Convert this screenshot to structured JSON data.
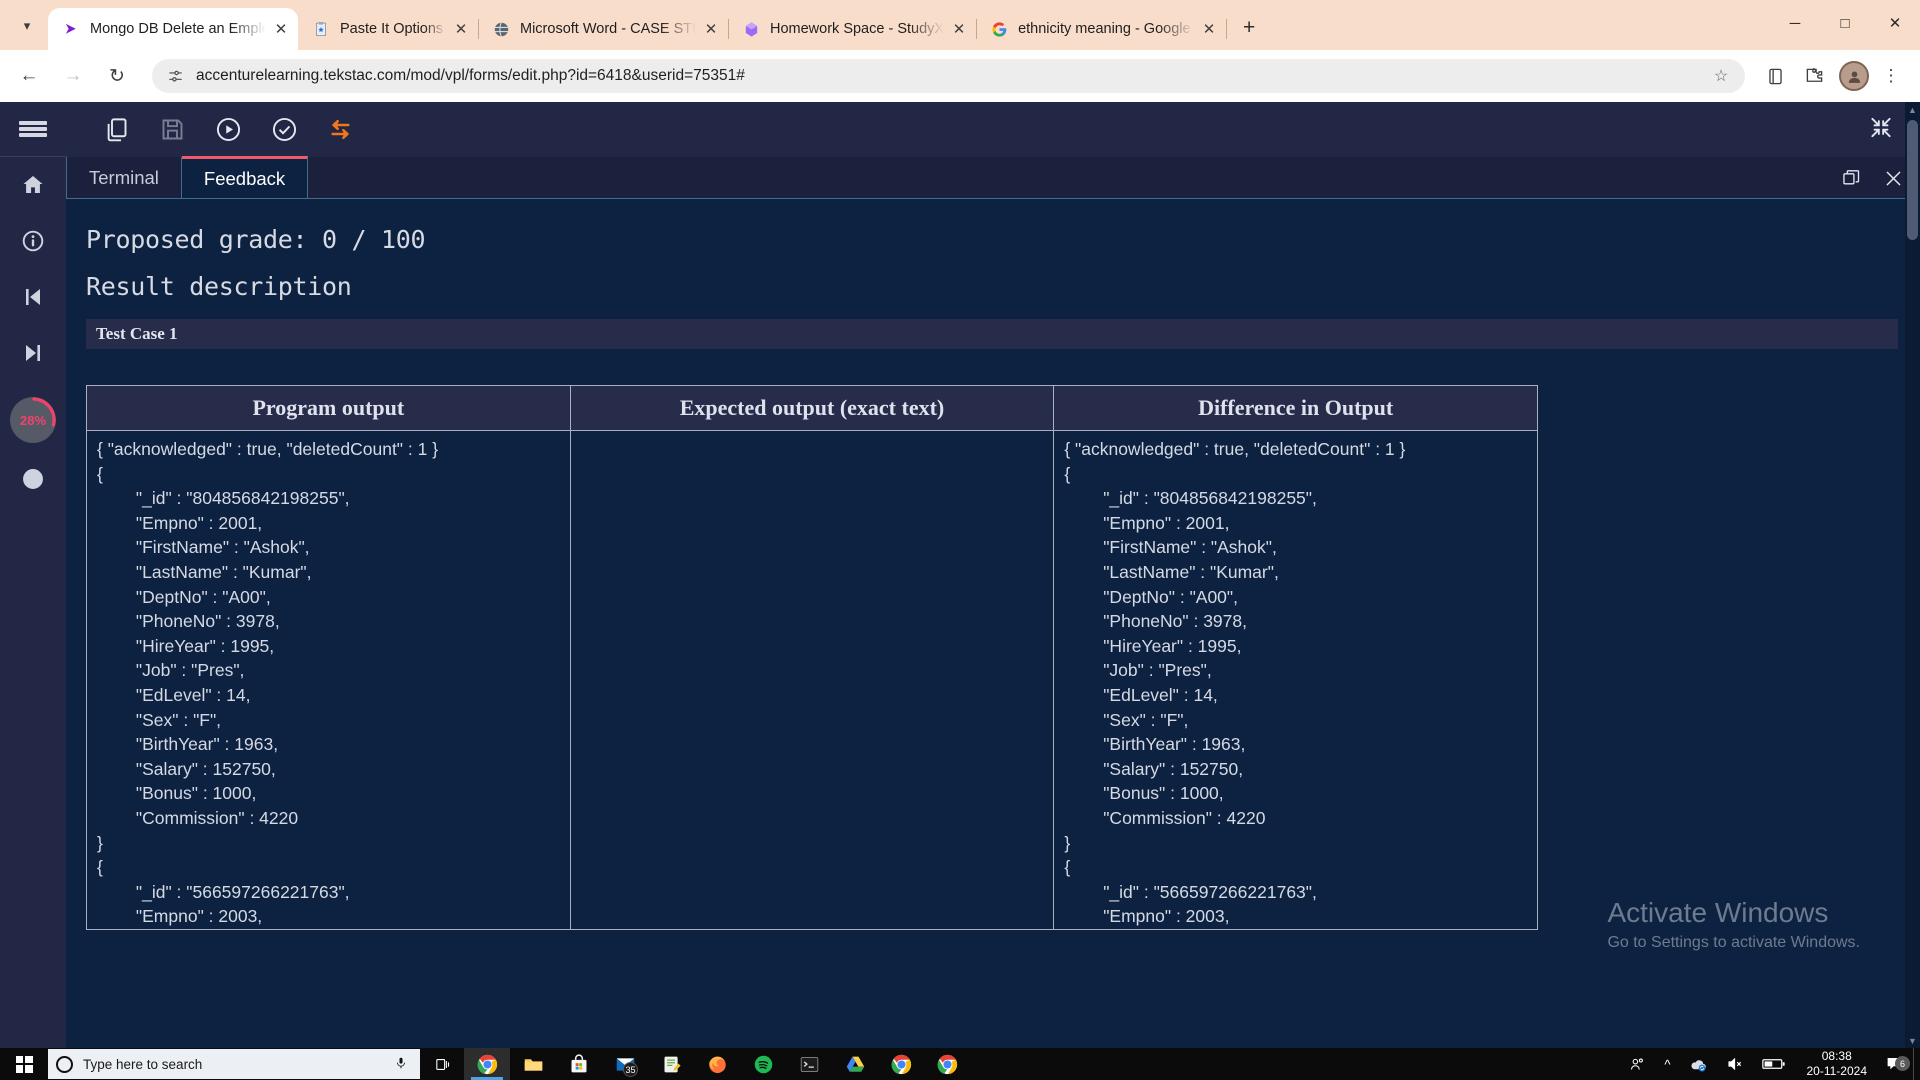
{
  "browser": {
    "tab_search_icon": "chevron-down-icon",
    "tabs": [
      {
        "title": "Mongo DB Delete an Employee",
        "favicon": "mongodb-icon",
        "active": true
      },
      {
        "title": "Paste It Options",
        "favicon": "clipboard-icon",
        "active": false
      },
      {
        "title": "Microsoft Word - CASE STUDY",
        "favicon": "word-globe-icon",
        "active": false
      },
      {
        "title": "Homework Space - StudyX",
        "favicon": "studyx-icon",
        "active": false
      },
      {
        "title": "ethnicity meaning - Google Sea",
        "favicon": "google-icon",
        "active": false
      }
    ],
    "new_tab_label": "+",
    "close_tab_label": "✕",
    "window_controls": {
      "minimize": "─",
      "maximize": "□",
      "close": "✕"
    },
    "nav": {
      "back": "←",
      "forward": "→",
      "reload": "↻"
    },
    "omnibox": {
      "url": "accenturelearning.tekstac.com/mod/vpl/forms/edit.php?id=6418&userid=75351#",
      "site_info_icon": "tune-icon",
      "bookmark_icon": "star-icon"
    },
    "toolbar_icons": [
      {
        "name": "reading-list-icon",
        "glyph": "☰"
      },
      {
        "name": "extensions-icon",
        "glyph": "⧉"
      },
      {
        "name": "profile-avatar",
        "glyph": ""
      },
      {
        "name": "chrome-menu-icon",
        "glyph": "⋮"
      }
    ]
  },
  "sidebar": {
    "hamburger": "menu-icon",
    "items": [
      {
        "name": "home-icon",
        "label": "Home"
      },
      {
        "name": "info-icon",
        "label": "Info"
      },
      {
        "name": "previous-icon",
        "label": "Previous"
      },
      {
        "name": "next-icon",
        "label": "Next"
      },
      {
        "name": "help-icon",
        "label": "Help"
      }
    ],
    "progress": {
      "value": "28%",
      "color": "#f0426b"
    }
  },
  "vpl_toolbar": {
    "buttons": [
      {
        "name": "copy-files-icon",
        "label": "Copy"
      },
      {
        "name": "save-icon",
        "label": "Save",
        "disabled": true
      },
      {
        "name": "run-icon",
        "label": "Run"
      },
      {
        "name": "evaluate-icon",
        "label": "Evaluate"
      },
      {
        "name": "reset-icon",
        "label": "Reset",
        "accent": "#f4761b"
      }
    ],
    "collapse_icon": "collapse-arrows-icon"
  },
  "panel": {
    "tabs": [
      {
        "label": "Terminal",
        "active": false
      },
      {
        "label": "Feedback",
        "active": true
      }
    ],
    "restore_icon": "restore-window-icon",
    "close_icon": "close-panel-icon"
  },
  "feedback": {
    "proposed_grade": "Proposed grade: 0 / 100",
    "result_description": "Result description",
    "test_case_label": "Test Case 1",
    "table": {
      "headers": [
        "Program output",
        "Expected output (exact text)",
        "Difference in Output"
      ],
      "program_output": "{ \"acknowledged\" : true, \"deletedCount\" : 1 }\n{\n\t\"_id\" : \"804856842198255\",\n\t\"Empno\" : 2001,\n\t\"FirstName\" : \"Ashok\",\n\t\"LastName\" : \"Kumar\",\n\t\"DeptNo\" : \"A00\",\n\t\"PhoneNo\" : 3978,\n\t\"HireYear\" : 1995,\n\t\"Job\" : \"Pres\",\n\t\"EdLevel\" : 14,\n\t\"Sex\" : \"F\",\n\t\"BirthYear\" : 1963,\n\t\"Salary\" : 152750,\n\t\"Bonus\" : 1000,\n\t\"Commission\" : 4220\n}\n{\n\t\"_id\" : \"566597266221763\",\n\t\"Empno\" : 2003,",
      "expected_output": "",
      "difference_output": "{ \"acknowledged\" : true, \"deletedCount\" : 1 }\n{\n\t\"_id\" : \"804856842198255\",\n\t\"Empno\" : 2001,\n\t\"FirstName\" : \"Ashok\",\n\t\"LastName\" : \"Kumar\",\n\t\"DeptNo\" : \"A00\",\n\t\"PhoneNo\" : 3978,\n\t\"HireYear\" : 1995,\n\t\"Job\" : \"Pres\",\n\t\"EdLevel\" : 14,\n\t\"Sex\" : \"F\",\n\t\"BirthYear\" : 1963,\n\t\"Salary\" : 152750,\n\t\"Bonus\" : 1000,\n\t\"Commission\" : 4220\n}\n{\n\t\"_id\" : \"566597266221763\",\n\t\"Empno\" : 2003,"
    }
  },
  "watermark": {
    "title": "Activate Windows",
    "subtitle": "Go to Settings to activate Windows."
  },
  "taskbar": {
    "start_label": "Start",
    "search_placeholder": "Type here to search",
    "mic_icon": "microphone-icon",
    "taskview_icon": "task-view-icon",
    "apps": [
      {
        "name": "chrome-taskbar-icon",
        "label": "Google Chrome",
        "active": true
      },
      {
        "name": "file-explorer-icon",
        "label": "File Explorer"
      },
      {
        "name": "microsoft-store-icon",
        "label": "Microsoft Store"
      },
      {
        "name": "mail-icon",
        "label": "Mail",
        "badge": "35"
      },
      {
        "name": "notes-icon",
        "label": "Notes"
      },
      {
        "name": "firefox-icon",
        "label": "Firefox"
      },
      {
        "name": "spotify-icon",
        "label": "Spotify"
      },
      {
        "name": "terminal-icon",
        "label": "Terminal"
      },
      {
        "name": "drive-icon",
        "label": "Drive"
      },
      {
        "name": "chrome-window-icon",
        "label": "Chrome Window"
      },
      {
        "name": "chrome-window-2-icon",
        "label": "Chrome Window 2"
      },
      {
        "name": "chrome-window-3-icon",
        "label": "Chrome Window 3"
      }
    ],
    "tray": [
      {
        "name": "people-icon",
        "glyph": "὆4"
      },
      {
        "name": "show-hidden-icons-chevron",
        "glyph": "⌃"
      },
      {
        "name": "onedrive-icon",
        "glyph": "☁"
      },
      {
        "name": "volume-muted-icon",
        "glyph": "ὐ7"
      },
      {
        "name": "battery-icon",
        "glyph": "▭"
      }
    ],
    "clock": {
      "time": "08:38",
      "date": "20-11-2024"
    },
    "notification_count": "6"
  }
}
